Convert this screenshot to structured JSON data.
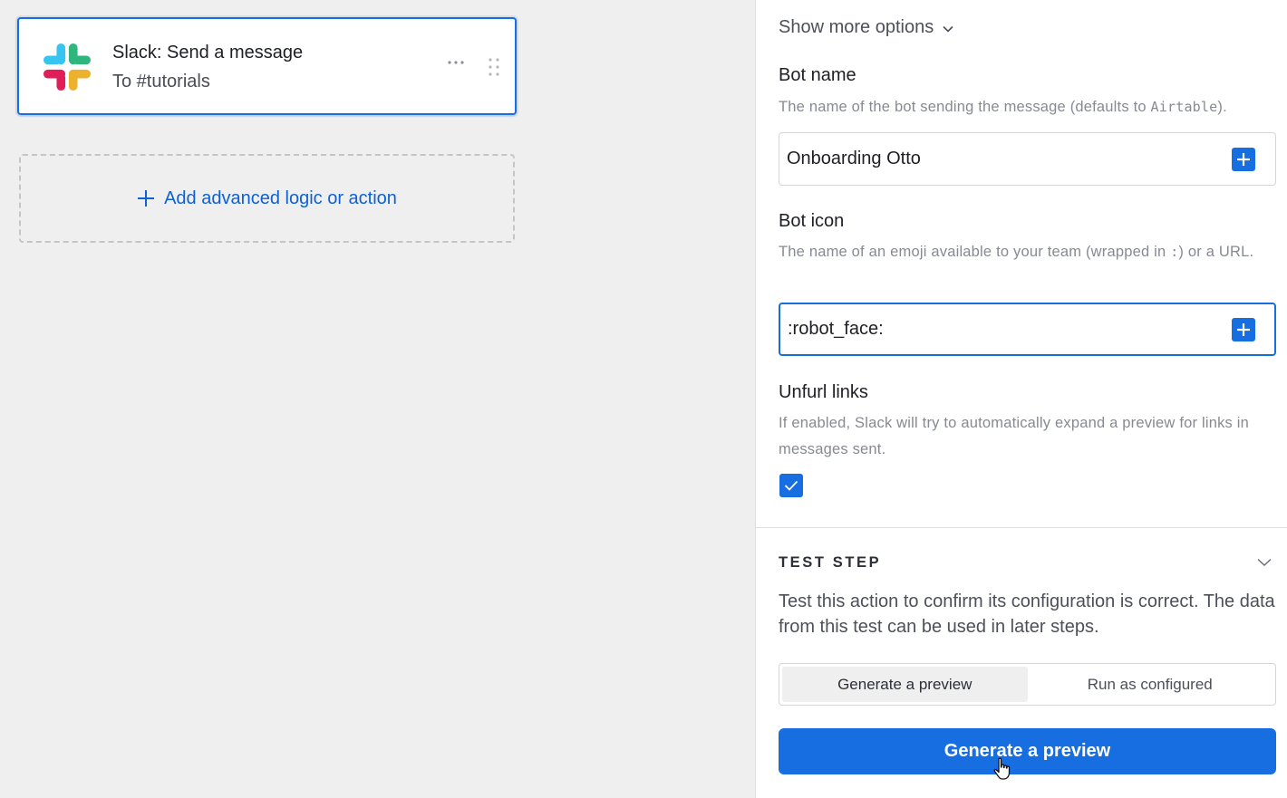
{
  "canvas": {
    "action_card": {
      "title": "Slack: Send a message",
      "subtitle": "To #tutorials",
      "more_icon": "ellipsis-icon",
      "drag_icon": "drag-handle-icon",
      "logo_icon": "slack-logo-icon"
    },
    "add_logic": {
      "label": "Add advanced logic or action",
      "icon": "plus-icon"
    }
  },
  "panel": {
    "show_more_label": "Show more options",
    "bot_name": {
      "label": "Bot name",
      "help_prefix": "The name of the bot sending the message (defaults to ",
      "help_code": "Airtable",
      "help_suffix": ").",
      "value": "Onboarding Otto"
    },
    "bot_icon": {
      "label": "Bot icon",
      "help_prefix": "The name of an emoji available to your team (wrapped in ",
      "help_code": ":",
      "help_suffix": ") or a URL.",
      "value": ":robot_face:"
    },
    "unfurl_links": {
      "label": "Unfurl links",
      "help": "If enabled, Slack will try to automatically expand a preview for links in messages sent.",
      "checked": true
    },
    "test_step": {
      "heading": "TEST STEP",
      "description": "Test this action to confirm its configuration is correct. The data from this test can be used in later steps.",
      "modes": [
        "Generate a preview",
        "Run as configured"
      ],
      "selected_mode": "Generate a preview",
      "button_label": "Generate a preview"
    }
  },
  "colors": {
    "accent": "#166ee1",
    "link": "#0d61d4",
    "canvas_bg": "#efefef"
  }
}
